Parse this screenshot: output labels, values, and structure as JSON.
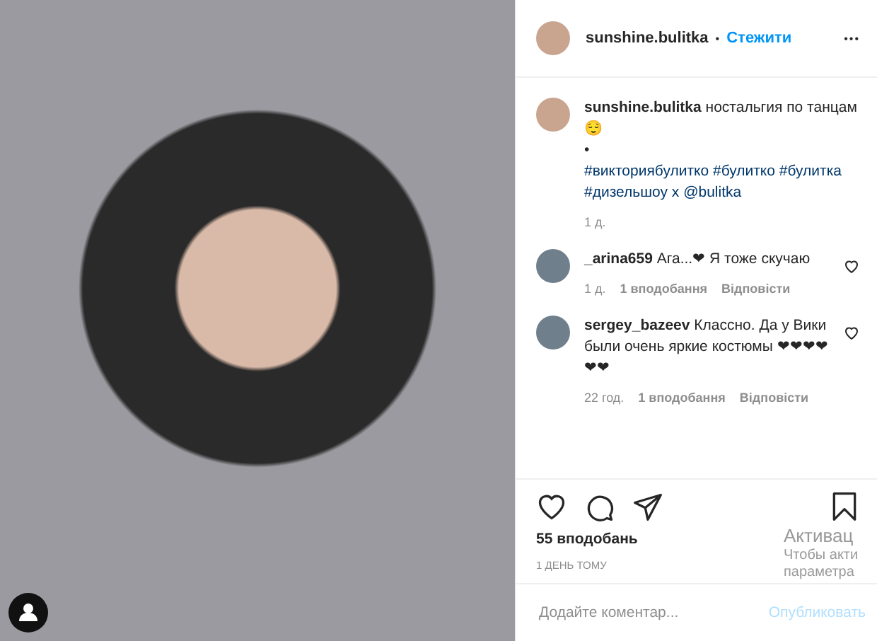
{
  "header": {
    "username": "sunshine.bulitka",
    "separator": "•",
    "follow": "Стежити",
    "more": "•••"
  },
  "caption": {
    "username": "sunshine.bulitka",
    "text": "ностальгия по танцам😌",
    "bullet": "•",
    "hashtags": "#викториябулитко #булитко #булитка #дизельшоу х @bulitka",
    "time": "1 д."
  },
  "comments": [
    {
      "username": "_arina659",
      "text": "Ага...❤ Я тоже скучаю",
      "time": "1 д.",
      "likes": "1 вподобання",
      "reply": "Відповісти",
      "liked": false
    },
    {
      "username": "sergey_bazeev",
      "text": "Классно. Да у Вики были очень яркие костюмы ❤❤❤❤❤❤",
      "time": "22 год.",
      "likes": "1 вподобання",
      "reply": "Відповісти",
      "liked": false
    }
  ],
  "likes": "55 вподобань",
  "date": "1 ДЕНЬ ТОМУ",
  "comment_box": {
    "placeholder": "Додайте коментар...",
    "post_button": "Опубликовать"
  },
  "overlay": [
    "Активац",
    "Чтобы акти",
    "параметра"
  ]
}
